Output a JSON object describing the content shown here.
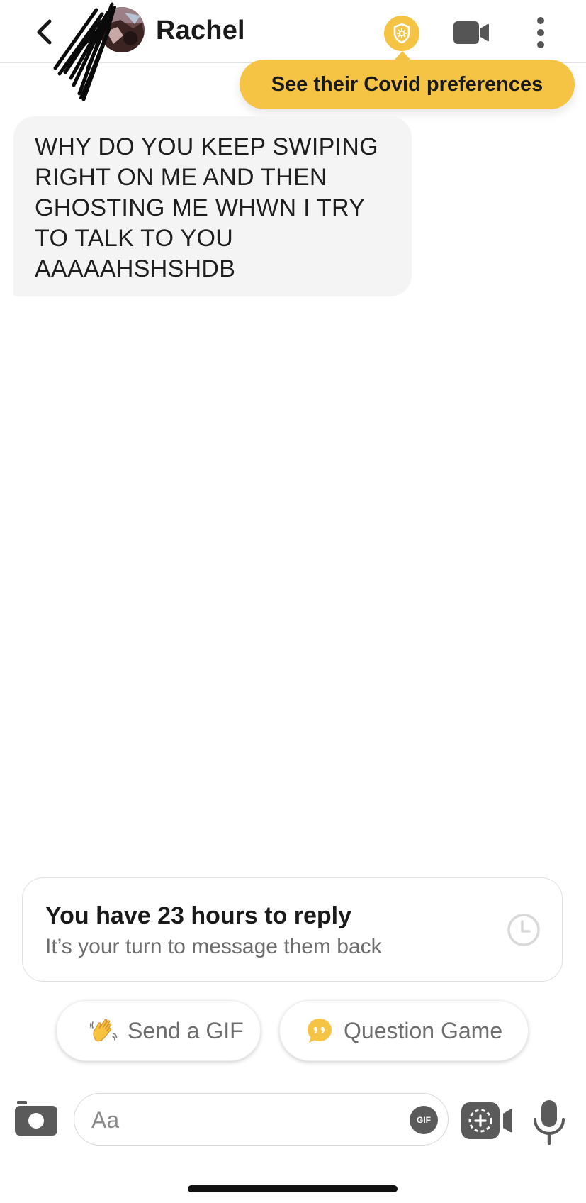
{
  "header": {
    "contact_name": "Rachel",
    "icons": {
      "back": "chevron-left-icon",
      "covid": "shield-virus-icon",
      "video": "video-camera-icon",
      "more": "more-vertical-icon"
    }
  },
  "tooltip": {
    "text": "See their Covid preferences"
  },
  "messages": [
    {
      "sender": "Rachel",
      "text": "WHY DO YOU KEEP SWIPING RIGHT ON ME AND THEN GHOSTING ME WHWN I TRY TO TALK TO YOU AAAAAHSHSHDB"
    }
  ],
  "reply_timer": {
    "title": "You have 23 hours to reply",
    "subtitle": "It’s your turn to message them back",
    "icon": "clock-icon"
  },
  "chips": {
    "gif": {
      "label": "Send a GIF",
      "icon": "waving-hand-icon"
    },
    "question": {
      "label": "Question Game",
      "icon": "quote-bubble-icon"
    }
  },
  "composer": {
    "placeholder": "Aa",
    "gif_label": "GIF",
    "icons": {
      "camera": "camera-icon",
      "video_note": "video-note-icon",
      "mic": "microphone-icon"
    }
  },
  "colors": {
    "accent": "#f6c445",
    "bubble": "#f4f4f4",
    "muted_text": "#6d6d6d"
  }
}
